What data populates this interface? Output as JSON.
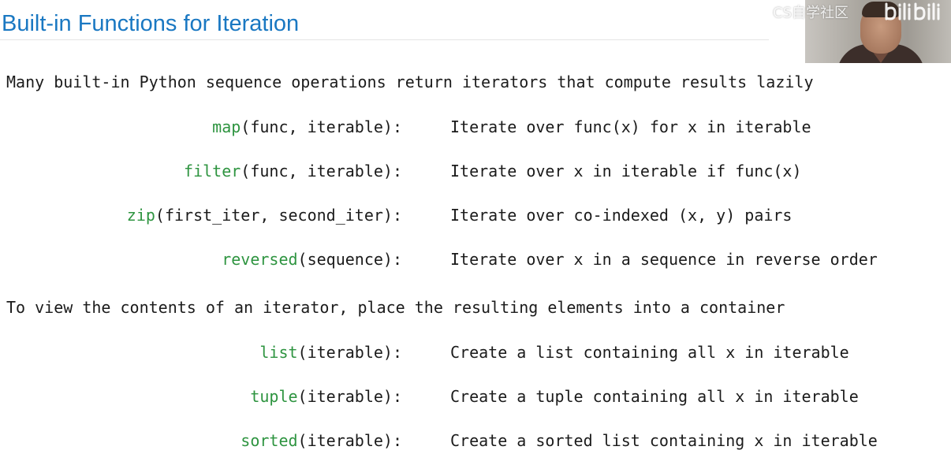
{
  "slide": {
    "title": "Built-in Functions for Iteration",
    "intro1": "Many built-in Python sequence operations return iterators that compute results lazily",
    "intro2": "To view the contents of an iterator, place the resulting elements into a container"
  },
  "colors": {
    "title": "#1a78c2",
    "function_name": "#2e9440",
    "text": "#1b1b1b"
  },
  "iterator_functions": [
    {
      "name": "map",
      "args": "(func, iterable):",
      "description": "Iterate over func(x) for x in iterable"
    },
    {
      "name": "filter",
      "args": "(func, iterable):",
      "description": "Iterate over x in iterable if func(x)"
    },
    {
      "name": "zip",
      "args": "(first_iter, second_iter):",
      "description": "Iterate over co-indexed (x, y) pairs"
    },
    {
      "name": "reversed",
      "args": "(sequence):",
      "description": "Iterate over x in a sequence in reverse order"
    }
  ],
  "container_functions": [
    {
      "name": "list",
      "args": "(iterable):",
      "description": "Create a list containing all x in iterable"
    },
    {
      "name": "tuple",
      "args": "(iterable):",
      "description": "Create a tuple containing all x in iterable"
    },
    {
      "name": "sorted",
      "args": "(iterable):",
      "description": "Create a sorted list containing x in iterable"
    }
  ],
  "overlay": {
    "watermark": "CS自学社区",
    "logo": "bilibili-logo"
  }
}
